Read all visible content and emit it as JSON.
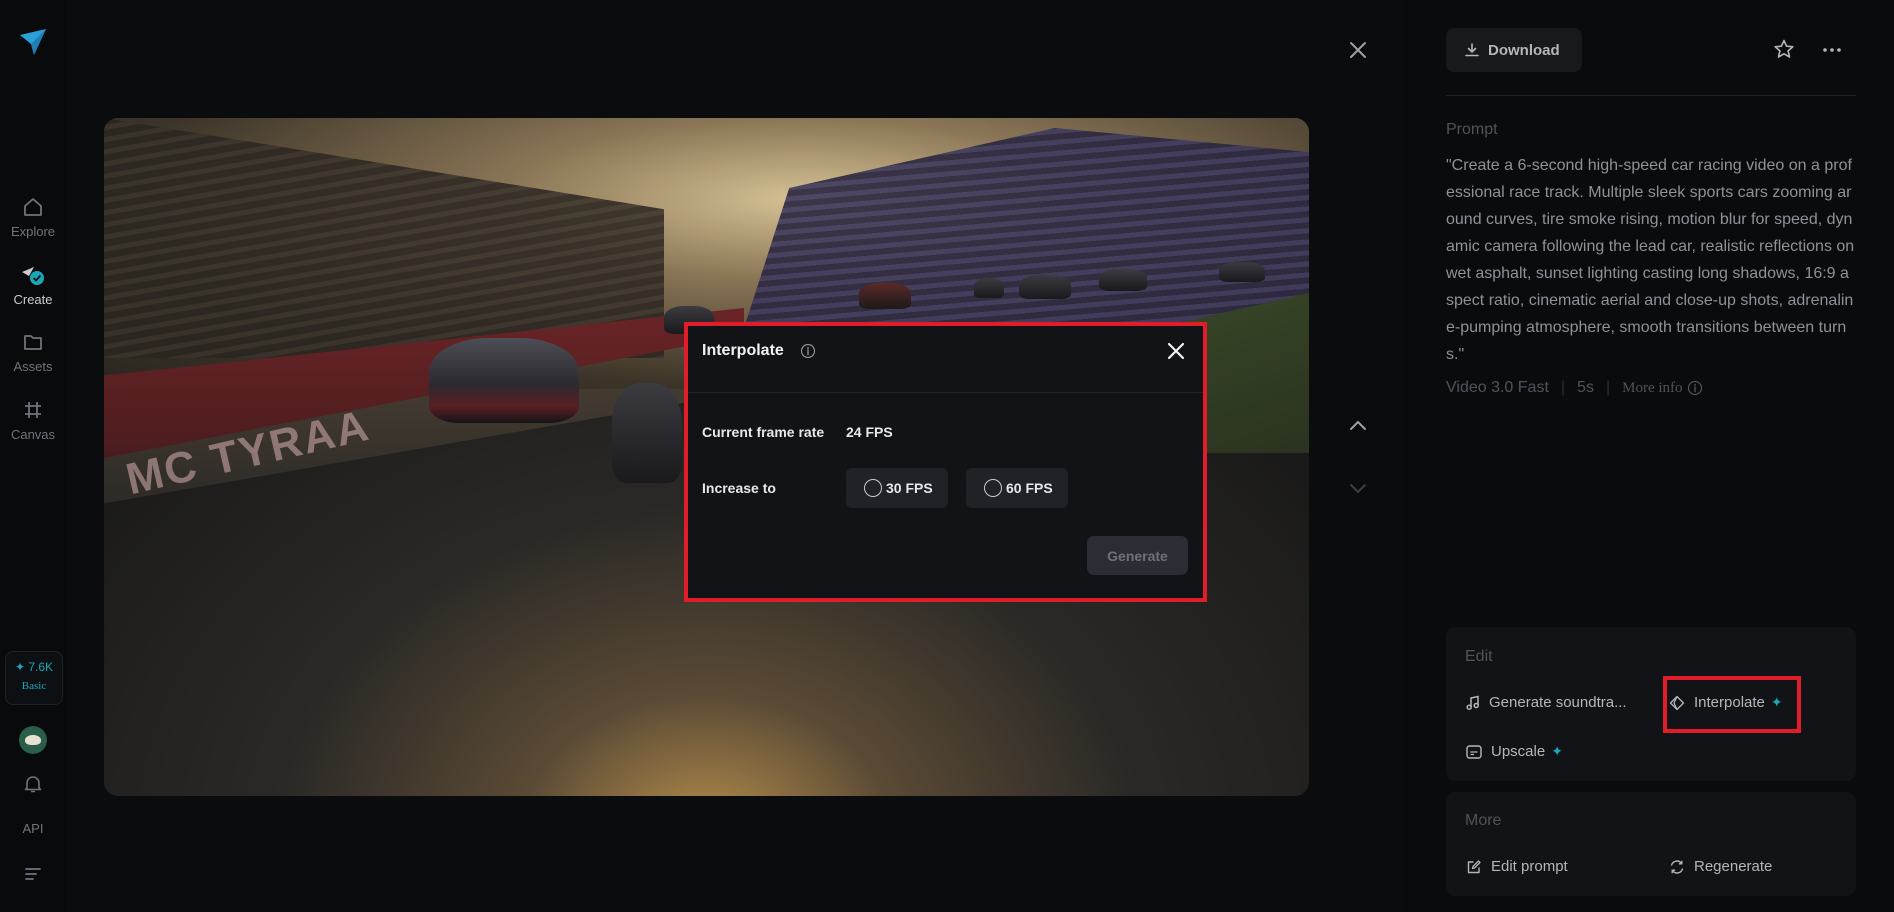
{
  "nav": {
    "items": [
      {
        "label": "Explore",
        "icon": "home-icon"
      },
      {
        "label": "Create",
        "icon": "create-icon"
      },
      {
        "label": "Assets",
        "icon": "folder-icon"
      },
      {
        "label": "Canvas",
        "icon": "canvas-icon"
      }
    ],
    "credits": {
      "amount": "✦ 7.6K",
      "plan": "Basic"
    },
    "api_label": "API"
  },
  "video": {
    "wall_text": "MC TYRAA"
  },
  "modal": {
    "title": "Interpolate",
    "current_frame_rate_label": "Current frame rate",
    "current_frame_rate_value": "24 FPS",
    "increase_to_label": "Increase to",
    "options": [
      "30 FPS",
      "60 FPS"
    ],
    "generate_label": "Generate"
  },
  "details": {
    "download_label": "Download",
    "prompt_label": "Prompt",
    "prompt_text": "\"Create a 6-second high-speed car racing video on a professional race track. Multiple sleek sports cars zooming around curves, tire smoke rising, motion blur for speed, dynamic camera following the lead car, realistic reflections on wet asphalt, sunset lighting casting long shadows, 16:9 aspect ratio, cinematic aerial and close-up shots, adrenaline-pumping atmosphere, smooth transitions between turns.\"",
    "model": "Video 3.0 Fast",
    "duration": "5s",
    "more_info": "More info"
  },
  "edit": {
    "title": "Edit",
    "generate_soundtrack": "Generate soundtra...",
    "interpolate": "Interpolate",
    "upscale": "Upscale"
  },
  "more": {
    "title": "More",
    "edit_prompt": "Edit prompt",
    "regenerate": "Regenerate"
  },
  "colors": {
    "accent": "#1aa7b8",
    "highlight": "#e11d2a"
  }
}
